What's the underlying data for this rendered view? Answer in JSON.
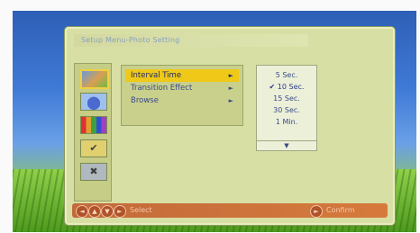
{
  "window": {
    "title": "Setup Menu-Photo Setting"
  },
  "left_icons": [
    {
      "name": "photo-icon",
      "symbol": ""
    },
    {
      "name": "music-icon",
      "symbol": ""
    },
    {
      "name": "video-icon",
      "symbol": ""
    },
    {
      "name": "tools-icon",
      "symbol": "✔"
    },
    {
      "name": "exit-icon",
      "symbol": "✖"
    }
  ],
  "menu": {
    "items": [
      {
        "label": "Interval Time",
        "arrow": "►"
      },
      {
        "label": "Transition Effect",
        "arrow": "►"
      },
      {
        "label": "Browse",
        "arrow": "►"
      }
    ],
    "selected_index": 0
  },
  "interval_options": [
    {
      "label": "5 Sec.",
      "checked": false
    },
    {
      "label": "✔ 10 Sec.",
      "checked": true
    },
    {
      "label": "15 Sec.",
      "checked": false
    },
    {
      "label": "30 Sec.",
      "checked": false
    },
    {
      "label": "1 Min.",
      "checked": false
    }
  ],
  "interval_more": "▼",
  "footer": {
    "nav_symbols": [
      "◄",
      "▲",
      "▼",
      "►"
    ],
    "select_label": "Select",
    "confirm_symbol": "►",
    "confirm_label": "Confirm"
  },
  "colors": {
    "panel_bg": "#d8dfa4",
    "highlight": "#f0c818",
    "footer_bg": "#c26a3a",
    "text_blue": "#3a4a8a"
  }
}
